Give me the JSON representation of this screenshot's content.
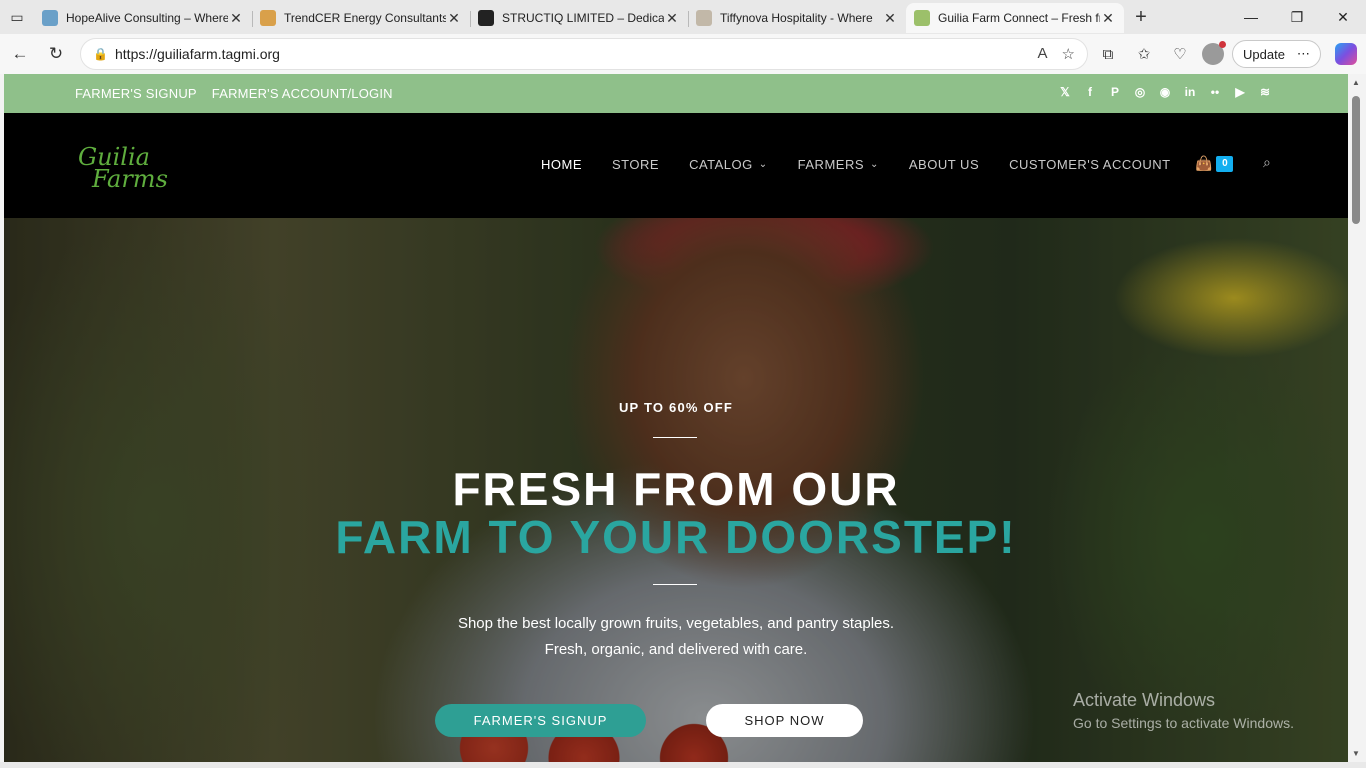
{
  "browser": {
    "tabs": [
      {
        "title": "HopeAlive Consulting – Where",
        "favicon_color": "#6aa0c8"
      },
      {
        "title": "TrendCER Energy Consultants",
        "favicon_color": "#d9a04a"
      },
      {
        "title": "STRUCTIQ LIMITED – Dedicate",
        "favicon_color": "#222222"
      },
      {
        "title": "Tiffynova Hospitality - Where",
        "favicon_color": "#c2b8a8"
      },
      {
        "title": "Guilia Farm Connect – Fresh fr",
        "favicon_color": "#9cc06a"
      }
    ],
    "url": "https://guiliafarm.tagmi.org",
    "update_label": "Update"
  },
  "topbar": {
    "links": [
      "FARMER'S SIGNUP",
      "FARMER'S ACCOUNT/LOGIN"
    ],
    "social_icons": [
      "x-icon",
      "facebook-icon",
      "pinterest-icon",
      "dribbble-icon",
      "instagram-icon",
      "linkedin-icon",
      "flickr-icon",
      "youtube-icon",
      "rss-icon"
    ]
  },
  "logo": {
    "line1": "Guilia",
    "line2": "Farms"
  },
  "nav": {
    "items": [
      "HOME",
      "STORE",
      "CATALOG",
      "FARMERS",
      "ABOUT US",
      "CUSTOMER'S ACCOUNT"
    ],
    "cart_count": "0"
  },
  "hero": {
    "kicker": "UP TO 60% OFF",
    "headline_line1": "FRESH FROM OUR",
    "headline_line2": "FARM TO YOUR DOORSTEP!",
    "sub_line1": "Shop the best locally grown fruits, vegetables, and pantry staples.",
    "sub_line2": "Fresh, organic, and delivered with care.",
    "btn_primary": "FARMER'S SIGNUP",
    "btn_secondary": "SHOP NOW"
  },
  "watermark": {
    "line1": "Activate Windows",
    "line2": "Go to Settings to activate Windows."
  },
  "colors": {
    "topbar_green": "#8fc08a",
    "accent_teal": "#2aa6a0",
    "button_teal": "#2e9f94",
    "cart_badge": "#13aff0"
  }
}
